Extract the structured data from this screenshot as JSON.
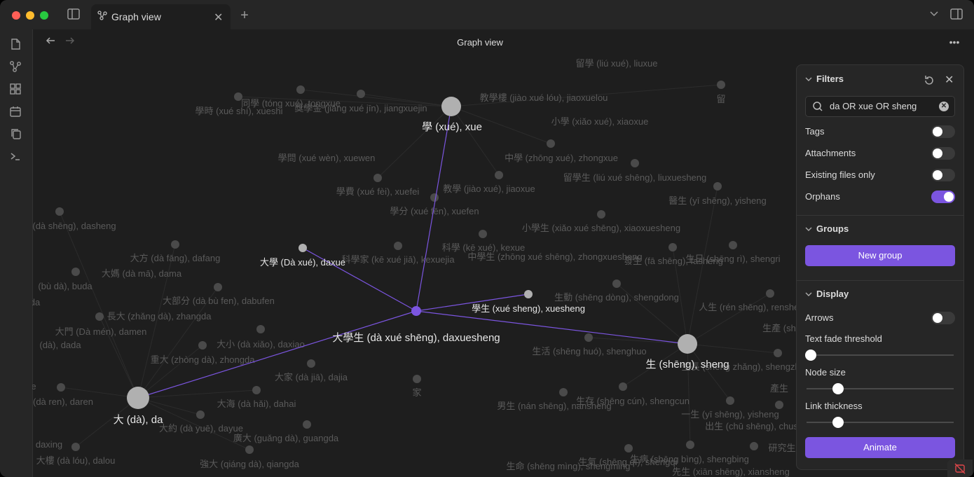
{
  "tab": {
    "title": "Graph view"
  },
  "view": {
    "title": "Graph view"
  },
  "graph": {
    "focus_nodes": [
      {
        "label": "學 (xué), xue"
      },
      {
        "label": "大學 (Dà xué), daxue"
      },
      {
        "label": "學生 (xué sheng), xuesheng"
      },
      {
        "label": "大學生 (dà xué shēng), daxuesheng"
      },
      {
        "label": "生 (shēng), sheng"
      },
      {
        "label": "大 (dà), da"
      }
    ],
    "faded_labels": [
      "留學 (liú xué), liuxue",
      "同學 (tóng xué), tongxue",
      "學時 (xué shí), xueshi",
      "獎學金 (jiǎng xué jīn), jiangxuejin",
      "教學樓 (jiào xué lóu), jiaoxuelou",
      "留",
      "小學 (xiǎo xué), xiaoxue",
      "學問 (xué wèn), xuewen",
      "中學 (zhōng xué), zhongxue",
      "留學生 (liú xué shēng), liuxuesheng",
      "學費 (xué fèi), xuefei",
      "教學 (jiào xué), jiaoxue",
      "醫生 (yī shēng), yisheng",
      "學分 (xué fēn), xuefen",
      "(dà shēng), dasheng",
      "小學生 (xiǎo xué shēng), xiaoxuesheng",
      "大方 (dà fāng), dafang",
      "科學 (kē xué), kexue",
      "中學生 (zhōng xué shēng), zhongxuesheng",
      "科學家 (kē xué jiā), kexuejia",
      "發生 (fā shēng), fasheng",
      "生日 (shēng rì), shengri",
      "大媽 (dà mā), dama",
      "(bù dà), buda",
      "生動 (shēng dòng), shengdong",
      "大部分 (dà bù fen), dabufen",
      "人生 (rén shēng), rensheng",
      "長大 (zhǎng dà), zhangda",
      "大門 (Dà mén), damen",
      "大小 (dà xiǎo), daxiao",
      "(dà), dada",
      "生活 (shēng huó), shenghuo",
      "重大 (zhòng dà), zhongda",
      "生長 (shēng zhǎng), shengzhang",
      "大家 (dà jiā), dajia",
      "家",
      "(dà ren), daren",
      "大海 (dà hǎi), dahai",
      "生存 (shēng cún), shengcun",
      "男生 (nán shēng), nansheng",
      "一生 (yī shēng), yisheng",
      "大約 (dà yuē), dayue",
      "出生 (chū shēng), chusheng",
      "廣大 (guǎng dà), guangda",
      "daxing",
      "研究生",
      "大樓 (dà lóu), dalou",
      "強大 (qiáng dà), qiangda",
      "生病 (shēng bìng), shengbing",
      "生命 (shēng mìng), shengming",
      "生氣 (shēng qì), shengqi",
      "先生 (xiān shēng), xiansheng",
      "產生",
      "生產 (sh",
      "da",
      "e"
    ]
  },
  "panel": {
    "filters": {
      "title": "Filters",
      "search_value": "da OR xue OR sheng",
      "rows": [
        {
          "label": "Tags",
          "on": false
        },
        {
          "label": "Attachments",
          "on": false
        },
        {
          "label": "Existing files only",
          "on": false
        },
        {
          "label": "Orphans",
          "on": true
        }
      ]
    },
    "groups": {
      "title": "Groups",
      "button": "New group"
    },
    "display": {
      "title": "Display",
      "arrows": {
        "label": "Arrows",
        "on": false
      },
      "sliders": [
        {
          "label": "Text fade threshold",
          "value": 0.0
        },
        {
          "label": "Node size",
          "value": 0.2
        },
        {
          "label": "Link thickness",
          "value": 0.2
        }
      ],
      "animate_button": "Animate"
    }
  },
  "colors": {
    "accent": "#7b55e0",
    "node_focus": "#b0b0b0",
    "node_faded": "#4a4a4a"
  }
}
